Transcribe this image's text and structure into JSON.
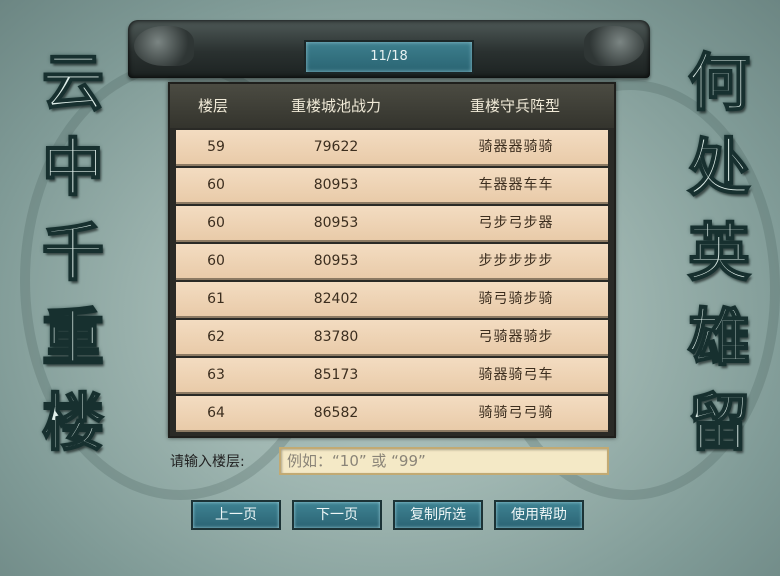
{
  "left_banner": [
    "云",
    "中",
    "千",
    "重",
    "楼"
  ],
  "right_banner": [
    "何",
    "处",
    "英",
    "雄",
    "留"
  ],
  "page_indicator": "11/18",
  "table": {
    "headers": [
      "楼层",
      "重楼城池战力",
      "重楼守兵阵型"
    ],
    "rows": [
      {
        "floor": "59",
        "power": "79622",
        "formation": "骑器器骑骑"
      },
      {
        "floor": "60",
        "power": "80953",
        "formation": "车器器车车"
      },
      {
        "floor": "60",
        "power": "80953",
        "formation": "弓步弓步器"
      },
      {
        "floor": "60",
        "power": "80953",
        "formation": "步步步步步"
      },
      {
        "floor": "61",
        "power": "82402",
        "formation": "骑弓骑步骑"
      },
      {
        "floor": "62",
        "power": "83780",
        "formation": "弓骑器骑步"
      },
      {
        "floor": "63",
        "power": "85173",
        "formation": "骑器骑弓车"
      },
      {
        "floor": "64",
        "power": "86582",
        "formation": "骑骑弓弓骑"
      }
    ]
  },
  "search": {
    "label": "请输入楼层:",
    "placeholder": "例如：“10” 或 “99”"
  },
  "buttons": {
    "prev": "上一页",
    "next": "下一页",
    "copy": "复制所选",
    "help": "使用帮助"
  },
  "colors": {
    "background": "#9fb6b1",
    "row_fill": "#f0d6b8",
    "header_fill": "#3e3e36",
    "button_fill": "#357484",
    "input_fill": "#f4e9c6"
  }
}
